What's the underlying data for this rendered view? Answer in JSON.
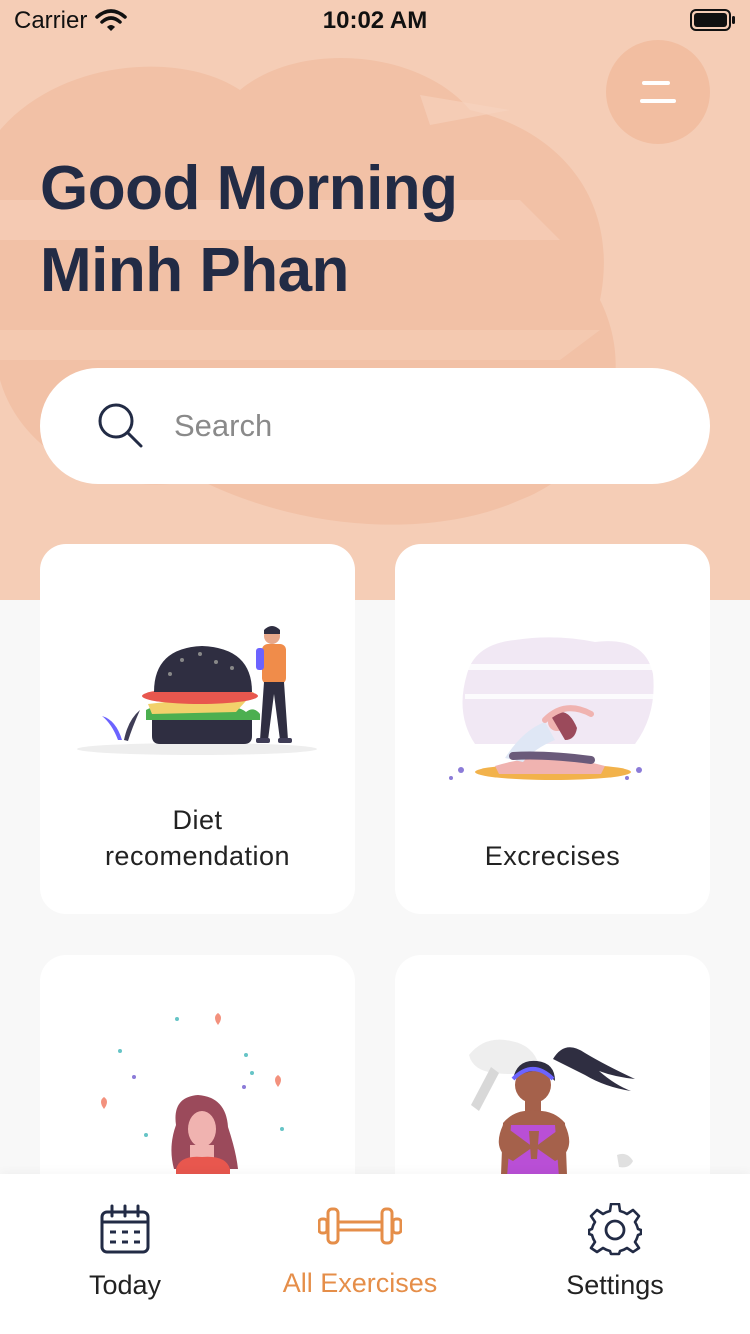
{
  "status_bar": {
    "carrier": "Carrier",
    "time": "10:02 AM"
  },
  "greeting": {
    "line1": "Good Morning",
    "line2": "Minh Phan"
  },
  "search": {
    "placeholder": "Search"
  },
  "categories": [
    {
      "label_line1": "Diet",
      "label_line2": "recomendation",
      "illustration": "burger-person-illustration"
    },
    {
      "label": "Excrecises",
      "illustration": "yoga-stretch-illustration"
    },
    {
      "label": "",
      "illustration": "meditation-woman-illustration"
    },
    {
      "label": "",
      "illustration": "yoga-namaste-illustration"
    }
  ],
  "tabs": [
    {
      "label": "Today",
      "icon": "calendar-icon",
      "active": false
    },
    {
      "label": "All Exercises",
      "icon": "dumbbell-icon",
      "active": true
    },
    {
      "label": "Settings",
      "icon": "gear-icon",
      "active": false
    }
  ],
  "colors": {
    "hero_bg": "#f5cdb6",
    "accent": "#e58e49",
    "title": "#222b45",
    "page_bg": "#f8f8f8"
  }
}
